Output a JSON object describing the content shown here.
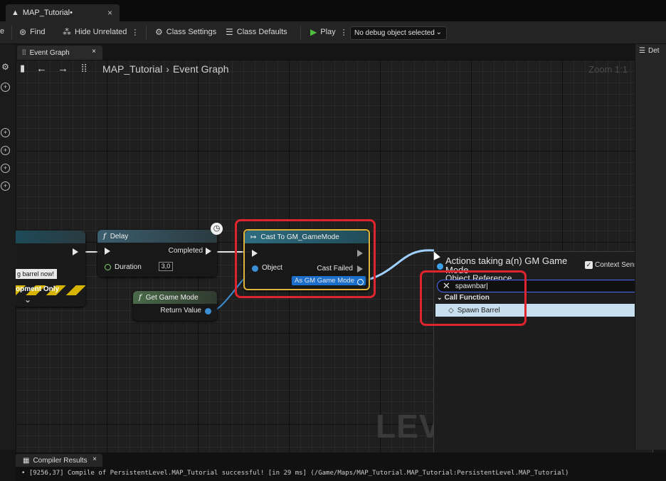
{
  "window": {
    "doc_tab": "MAP_Tutorial•",
    "doc_tab_close": "×"
  },
  "toolbar": {
    "find": "Find",
    "hide_unrelated": "Hide Unrelated",
    "class_settings": "Class Settings",
    "class_defaults": "Class Defaults",
    "play": "Play",
    "debug_object": "No debug object selected"
  },
  "graph_tab": {
    "label": "Event Graph",
    "close": "×"
  },
  "breadcrumb": {
    "root": "MAP_Tutorial",
    "sep": "›",
    "current": "Event Graph"
  },
  "zoom": "Zoom 1:1",
  "watermark": "LEVI",
  "nodes": {
    "left": {
      "pill_text": "g barrel now!",
      "stripe_text": "opment Only",
      "expand": "⌄"
    },
    "delay": {
      "title": "Delay",
      "completed": "Completed",
      "duration_label": "Duration",
      "duration_value": "3,0"
    },
    "get_game_mode": {
      "title": "Get Game Mode",
      "return_value": "Return Value"
    },
    "cast": {
      "title": "Cast To GM_GameMode",
      "object": "Object",
      "cast_failed": "Cast Failed",
      "as_out": "As GM Game Mode"
    }
  },
  "context_menu": {
    "title_line1": "Actions taking a(n) GM Game Mode",
    "title_line2": "Object Reference",
    "context_sensitive": "Context Sensitive",
    "search_value": "spawnbar|",
    "category": "Call Function",
    "item": "Spawn Barrel"
  },
  "details_tab": "Det",
  "compiler": {
    "tab": "Compiler Results",
    "close": "×",
    "log": "• [9256,37] Compile of PersistentLevel.MAP_Tutorial successful! [in 29 ms] (/Game/Maps/MAP_Tutorial.MAP_Tutorial:PersistentLevel.MAP_Tutorial)"
  },
  "colors": {
    "highlight": "#e0242d",
    "cast_border": "#e0b43a",
    "wire": "#9fd0ff",
    "play_green": "#4fbf3f"
  },
  "icons": [
    "blueprint-icon",
    "find-icon",
    "hide-unrelated-icon",
    "gear-icon",
    "sliders-icon",
    "play-icon",
    "graph-icon",
    "clock-icon",
    "function-icon",
    "cast-icon",
    "clear-icon",
    "diamond-icon",
    "back-arrow-icon",
    "forward-arrow-icon"
  ]
}
